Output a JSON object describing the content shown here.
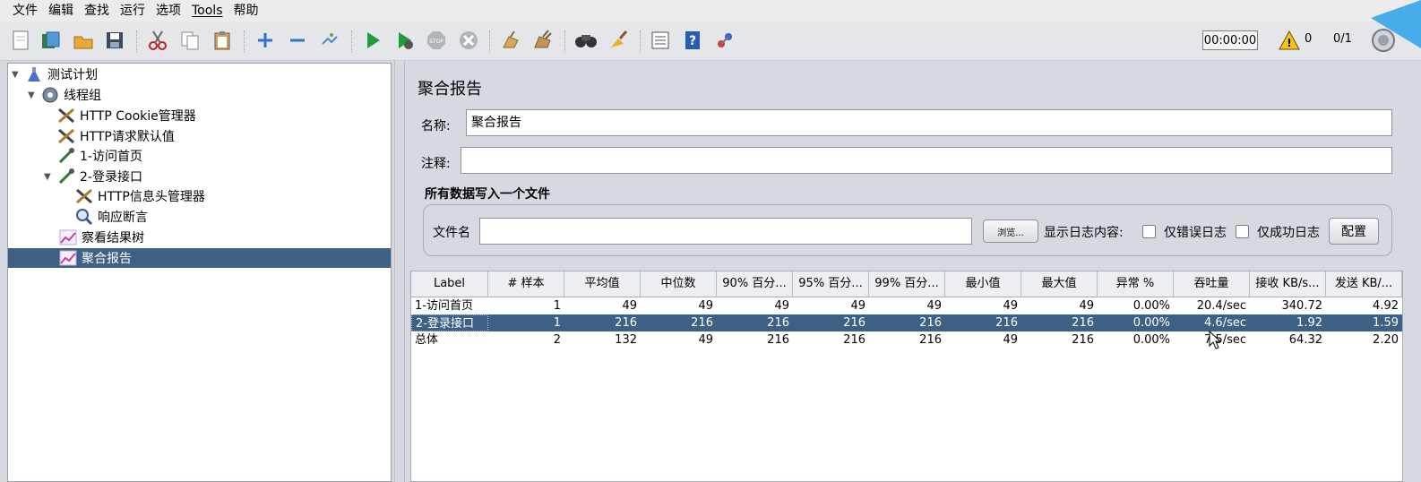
{
  "menu": [
    "文件",
    "编辑",
    "查找",
    "运行",
    "选项",
    "Tools",
    "帮助"
  ],
  "toolbar": {
    "timer": "00:00:00",
    "warning_count": "0",
    "threads": "0/1"
  },
  "tree": [
    {
      "label": "测试计划",
      "icon": "flask-icon"
    },
    {
      "label": "线程组",
      "icon": "gear-icon"
    },
    {
      "label": "HTTP Cookie管理器",
      "icon": "wrench-icon"
    },
    {
      "label": "HTTP请求默认值",
      "icon": "wrench-icon"
    },
    {
      "label": "1-访问首页",
      "icon": "pipette-icon"
    },
    {
      "label": "2-登录接口",
      "icon": "pipette-icon"
    },
    {
      "label": "HTTP信息头管理器",
      "icon": "wrench-icon"
    },
    {
      "label": "响应断言",
      "icon": "magnifier-icon"
    },
    {
      "label": "察看结果树",
      "icon": "chart-icon"
    },
    {
      "label": "聚合报告",
      "icon": "chart-icon"
    }
  ],
  "panel": {
    "title": "聚合报告",
    "name_label": "名称:",
    "name_value": "聚合报告",
    "comment_label": "注释:",
    "comment_value": "",
    "file_group_title": "所有数据写入一个文件",
    "file_name_label": "文件名",
    "file_name_value": "",
    "browse_label": "浏览...",
    "log_label": "显示日志内容:",
    "errors_only_label": "仅错误日志",
    "success_only_label": "仅成功日志",
    "configure_label": "配置"
  },
  "table": {
    "headers": [
      "Label",
      "# 样本",
      "平均值",
      "中位数",
      "90% 百分...",
      "95% 百分...",
      "99% 百分...",
      "最小值",
      "最大值",
      "异常 %",
      "吞吐量",
      "接收 KB/s...",
      "发送 KB/..."
    ],
    "rows": [
      [
        "1-访问首页",
        "1",
        "49",
        "49",
        "49",
        "49",
        "49",
        "49",
        "49",
        "0.00%",
        "20.4/sec",
        "340.72",
        "4.92"
      ],
      [
        "2-登录接口",
        "1",
        "216",
        "216",
        "216",
        "216",
        "216",
        "216",
        "216",
        "0.00%",
        "4.6/sec",
        "1.92",
        "1.59"
      ],
      [
        "总体",
        "2",
        "132",
        "49",
        "216",
        "216",
        "216",
        "49",
        "216",
        "0.00%",
        "7.5/sec",
        "64.32",
        "2.20"
      ]
    ]
  }
}
